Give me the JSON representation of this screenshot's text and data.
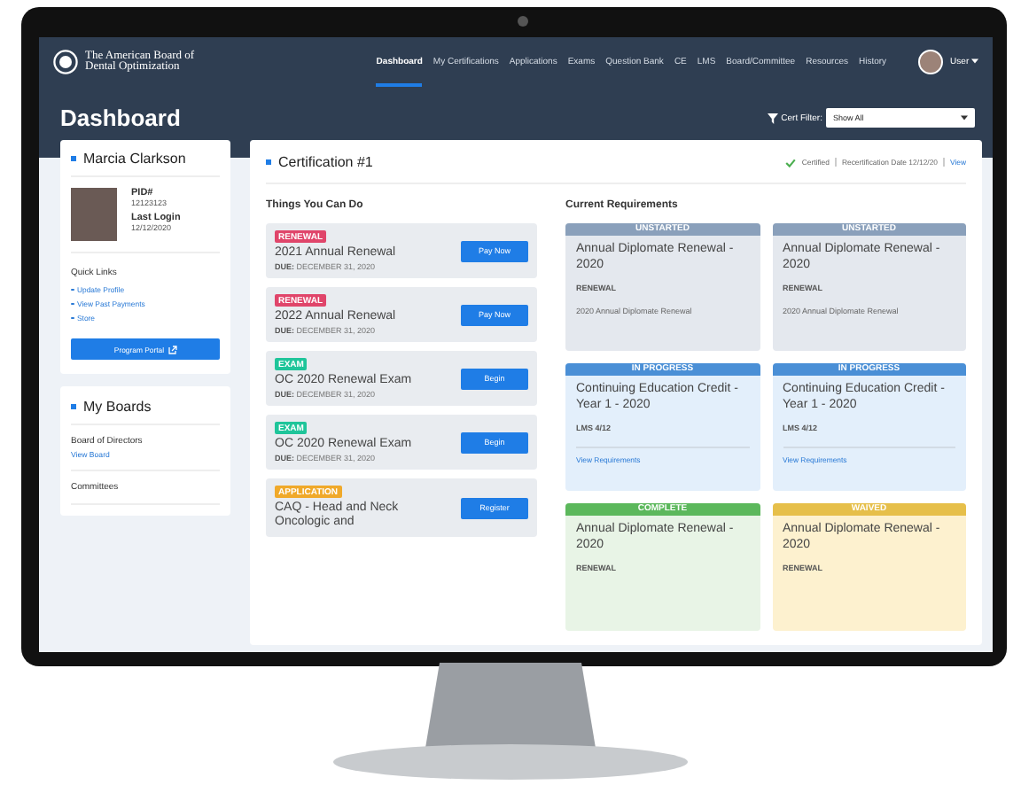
{
  "header": {
    "logo_text": "The American Board of Dental Optimization",
    "nav": [
      {
        "label": "Dashboard",
        "selected": true
      },
      {
        "label": "My Certifications",
        "selected": false
      },
      {
        "label": "Applications",
        "selected": false
      },
      {
        "label": "Exams",
        "selected": false
      },
      {
        "label": "Question Bank",
        "selected": false
      },
      {
        "label": "CE",
        "selected": false
      },
      {
        "label": "LMS",
        "selected": false
      },
      {
        "label": "Board/Committee",
        "selected": false
      },
      {
        "label": "Resources",
        "selected": false
      },
      {
        "label": "History",
        "selected": false
      }
    ],
    "user": "User"
  },
  "page_title": "Dashboard",
  "filter": {
    "label": "Cert Filter:",
    "value": "Show All"
  },
  "profile": {
    "name": "Marcia Clarkson",
    "fields": [
      {
        "label": "PID#",
        "value": "12123123"
      },
      {
        "label": "Last Login",
        "value": "12/12/2020"
      }
    ],
    "quick_links_title": "Quick Links",
    "links": [
      "Update Profile",
      "View Past Payments",
      "Store"
    ],
    "button": "Program Portal"
  },
  "boards": {
    "title": "My Boards",
    "items": [
      {
        "label": "Board of Directors",
        "link": "View Board"
      },
      {
        "label": "Committees"
      }
    ]
  },
  "certification": {
    "title": "Certification #1",
    "status": "Certified",
    "recert": "Recertification Date 12/12/20",
    "view": "View",
    "tasks_title": "Things You Can Do",
    "tasks": [
      {
        "tag": "RENEWAL",
        "kind": "renewal",
        "title": "2021 Annual Renewal",
        "due_label": "DUE:",
        "due": "DECEMBER 31, 2020",
        "button": "Pay Now"
      },
      {
        "tag": "RENEWAL",
        "kind": "renewal",
        "title": "2022 Annual Renewal",
        "due_label": "DUE:",
        "due": "DECEMBER 31, 2020",
        "button": "Pay Now"
      },
      {
        "tag": "EXAM",
        "kind": "exam",
        "title": "OC 2020 Renewal Exam",
        "due_label": "DUE:",
        "due": "DECEMBER 31, 2020",
        "button": "Begin"
      },
      {
        "tag": "EXAM",
        "kind": "exam",
        "title": "OC 2020 Renewal Exam",
        "due_label": "DUE:",
        "due": "DECEMBER 31, 2020",
        "button": "Begin"
      },
      {
        "tag": "APPLICATION",
        "kind": "application",
        "title": "CAQ - Head and Neck Oncologic and",
        "button": "Register"
      }
    ],
    "req_title": "Current Requirements",
    "requirements": [
      {
        "status": "UNSTARTED",
        "kind": "unstarted",
        "title": "Annual Diplomate Renewal - 2020",
        "type": "RENEWAL",
        "note": "2020 Annual Diplomate Renewal"
      },
      {
        "status": "UNSTARTED",
        "kind": "unstarted",
        "title": "Annual Diplomate Renewal - 2020",
        "type": "RENEWAL",
        "note": "2020 Annual Diplomate Renewal"
      },
      {
        "status": "IN PROGRESS",
        "kind": "progress",
        "title": "Continuing Education Credit - Year 1 - 2020",
        "type": "LMS 4/12",
        "link": "View Requirements"
      },
      {
        "status": "IN PROGRESS",
        "kind": "progress",
        "title": "Continuing Education Credit - Year 1 - 2020",
        "type": "LMS 4/12",
        "link": "View Requirements"
      },
      {
        "status": "COMPLETE",
        "kind": "complete",
        "title": "Annual Diplomate Renewal - 2020",
        "type": "RENEWAL"
      },
      {
        "status": "WAIVED",
        "kind": "waived",
        "title": "Annual Diplomate Renewal - 2020",
        "type": "RENEWAL"
      }
    ]
  }
}
